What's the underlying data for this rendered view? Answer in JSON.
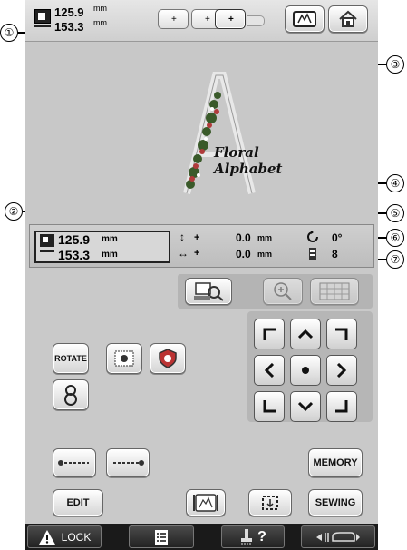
{
  "top_size": {
    "height": "125.9",
    "height_unit": "mm",
    "width": "153.3",
    "width_unit": "mm"
  },
  "callouts": [
    "①",
    "②",
    "③",
    "④",
    "⑤",
    "⑥",
    "⑦"
  ],
  "preview": {
    "line1": "Floral",
    "line2": "Alphabet"
  },
  "info_bar": {
    "height": "125.9",
    "height_unit": "mm",
    "width": "153.3",
    "width_unit": "mm",
    "v_offset_sign": "+",
    "v_offset": "0.0",
    "v_offset_unit": "mm",
    "h_offset_sign": "+",
    "h_offset": "0.0",
    "h_offset_unit": "mm",
    "angle": "0°",
    "color_count": "8"
  },
  "buttons": {
    "rotate": "ROTATE",
    "memory": "MEMORY",
    "edit": "EDIT",
    "sewing": "SEWING",
    "lock": "LOCK",
    "help": "?"
  },
  "icons": {
    "frame_icon": "hoop-frame-icon",
    "home_icon": "home-icon",
    "preview_icon": "magnify-preview-icon",
    "zoom_icon": "zoom-in-icon",
    "grid_icon": "grid-icon"
  }
}
